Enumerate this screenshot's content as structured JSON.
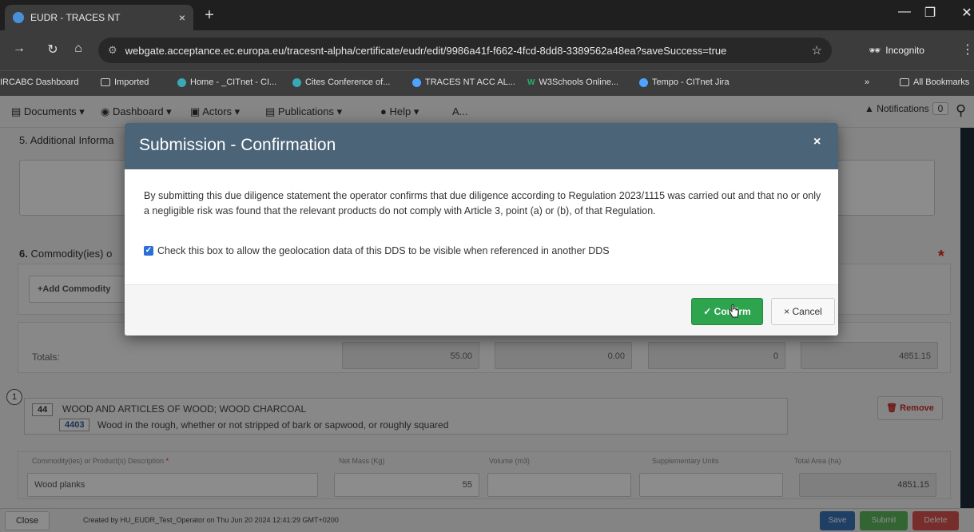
{
  "browser": {
    "tab_title": "EUDR - TRACES NT",
    "tab_close": "×",
    "new_tab": "+",
    "url": "webgate.acceptance.ec.europa.eu/tracesnt-alpha/certificate/eudr/edit/9986a41f-f662-4fcd-8dd8-3389562a48ea?saveSuccess=true",
    "incognito_label": "Incognito",
    "bookmarks": [
      "IRCABC Dashboard",
      "Imported",
      "Home - _CITnet - CI...",
      "Cites Conference of...",
      "TRACES NT ACC AL...",
      "W3Schools Online...",
      "Tempo - CITnet Jira"
    ],
    "bookmarks_more": "»",
    "all_bookmarks": "All Bookmarks"
  },
  "app_nav": {
    "items": [
      "Documents ▾",
      "Dashboard ▾",
      "Actors ▾",
      "Publications ▾",
      "Help ▾",
      "A..."
    ],
    "notifications_label": "Notifications",
    "notifications_count": "0"
  },
  "page": {
    "section5_title": "5. Additional Informa",
    "section6_num": "6.",
    "section6_title": " Commodity(ies) o",
    "add_commodity": "+Add Commodity",
    "totals_label": "Totals:",
    "totals": [
      "55.00",
      "0.00",
      "0",
      "4851.15"
    ],
    "item_number": "1",
    "hs_heading_code": "44",
    "hs_heading_text": "WOOD AND ARTICLES OF WOOD; WOOD CHARCOAL",
    "hs_sub_code": "4403",
    "hs_sub_text": "Wood in the rough, whether or not stripped of bark or sapwood, or roughly squared",
    "remove_label": "Remove",
    "columns": {
      "description": "Commodity(ies) or Product(s) Description",
      "net_mass": "Net Mass (Kg)",
      "volume": "Volume (m3)",
      "supp_units": "Supplementary Units",
      "total_area": "Total Area (ha)"
    },
    "row": {
      "description": "Wood planks",
      "net_mass": "55",
      "total_area": "4851.15"
    }
  },
  "footer": {
    "close_label": "Close",
    "created_text": "Created by HU_EUDR_Test_Operator on Thu Jun 20 2024 12:41:29 GMT+0200",
    "save_label": "Save",
    "submit_label": "Submit",
    "delete_label": "Delete"
  },
  "modal": {
    "title": "Submission - Confirmation",
    "close_glyph": "×",
    "body_text": "By submitting this due diligence statement the operator confirms that due diligence according to Regulation 2023/1115 was carried out and that no or only a negligible risk was found that the relevant products do not comply with Article 3, point (a) or (b), of that Regulation.",
    "checkbox_label": "Check this box to allow the geolocation data of this DDS to be visible when referenced in another DDS",
    "checkbox_checked": true,
    "confirm_label": "✓ Confirm",
    "cancel_label": "× Cancel"
  },
  "colors": {
    "modal_header": "#4b6478",
    "confirm": "#2ea44f",
    "save": "#3a73b8",
    "submit": "#5cb85c",
    "delete": "#d9534f"
  }
}
